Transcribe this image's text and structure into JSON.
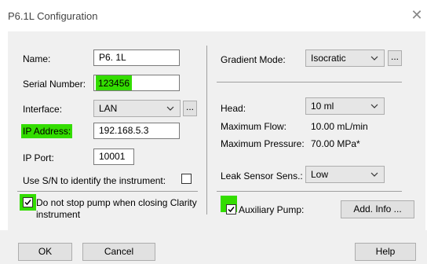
{
  "window": {
    "title": "P6.1L Configuration",
    "close_glyph": "✕"
  },
  "left": {
    "name_label": "Name:",
    "name_value": "P6. 1L",
    "serial_label": "Serial Number:",
    "serial_value": "123456",
    "interface_label": "Interface:",
    "interface_value": "LAN",
    "ip_label": "IP Address:",
    "ip_value": "192.168.5.3",
    "port_label": "IP Port:",
    "port_value": "10001",
    "use_sn_label": "Use S/N to identify the instrument:",
    "use_sn_checked": false,
    "nostop_label_line1": "Do not stop pump when closing Clarity",
    "nostop_label_line2": "instrument",
    "nostop_checked": true
  },
  "right": {
    "gradient_label": "Gradient Mode:",
    "gradient_value": "Isocratic",
    "head_label": "Head:",
    "head_value": "10 ml",
    "max_flow_label": "Maximum Flow:",
    "max_flow_value": "10.00 mL/min",
    "max_pressure_label": "Maximum Pressure:",
    "max_pressure_value": "70.00 MPa*",
    "leak_label": "Leak Sensor Sens.:",
    "leak_value": "Low",
    "aux_pump_label": "Auxiliary Pump:",
    "aux_pump_checked": true,
    "add_info_label": "Add. Info ..."
  },
  "ellipsis": "...",
  "footer": {
    "ok_label": "OK",
    "cancel_label": "Cancel",
    "help_label": "Help"
  },
  "colors": {
    "highlight": "#33dd00",
    "panel": "#f0f0f0"
  },
  "icons": [
    "close-icon",
    "chevron-down-icon",
    "checkmark-icon"
  ]
}
